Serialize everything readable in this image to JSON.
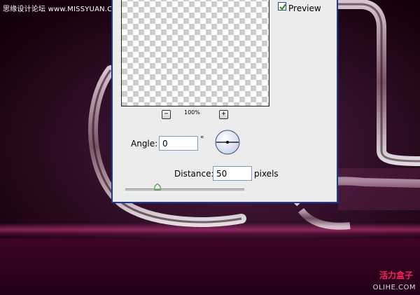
{
  "watermark": {
    "top_text": "思缘设计论坛 www.MISSYUAN.COM",
    "logo_text": "活力盒子",
    "site_text": "OLIHE.COM"
  },
  "dialog": {
    "preview": {
      "label": "Preview",
      "checked": true
    },
    "zoom": {
      "minus_label": "−",
      "plus_label": "+",
      "level": "100%"
    },
    "angle": {
      "label": "Angle:",
      "value": "0",
      "unit": "°"
    },
    "distance": {
      "label": "Distance:",
      "value": "50",
      "unit": "pixels"
    },
    "slider": {
      "value": 50,
      "max": 2000
    }
  },
  "colors": {
    "dialog_border": "#1d3b94",
    "dialog_bg": "#ececec",
    "background_magenta": "#5a1a3e",
    "checkmark_green": "#2a8a2a"
  }
}
